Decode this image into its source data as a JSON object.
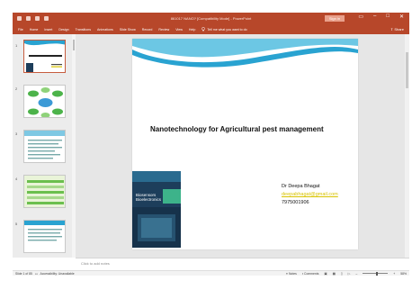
{
  "window": {
    "title": "861017 NANO? [Compatibility Mode] - PowerPoint",
    "signin_label": "Sign in",
    "controls": [
      "▭",
      "–",
      "□",
      "✕"
    ]
  },
  "ribbon": {
    "tabs": [
      "File",
      "Home",
      "Insert",
      "Design",
      "Transitions",
      "Animations",
      "Slide Show",
      "Record",
      "Review",
      "View",
      "Help"
    ],
    "tell_me": "Tell me what you want to do",
    "share": "Share"
  },
  "thumbnails": {
    "numbers": [
      "1",
      "2",
      "3",
      "4",
      "5"
    ]
  },
  "slide": {
    "title": "Nanotechnology for Agricultural pest management",
    "author_name": "Dr Deepa Bhagat",
    "author_email": "deepabhagat@gmail.com",
    "author_phone": "7975001906",
    "book_title_line1": "Biosensors",
    "book_title_line2": "Bioelectronics"
  },
  "notes": {
    "placeholder": "Click to add notes"
  },
  "status": {
    "slide_count": "Slide 1 of 85",
    "accessibility": "Accessibility: Unavailable",
    "notes_label": "Notes",
    "comments_label": "Comments",
    "zoom": "58%",
    "zoom_level": 0.55
  },
  "colors": {
    "accent": "#b7472a",
    "title_bar": "#b7472a",
    "email_color": "#d9c400",
    "wave_primary": "#29a3d1",
    "wave_secondary": "#6cc7e4"
  }
}
